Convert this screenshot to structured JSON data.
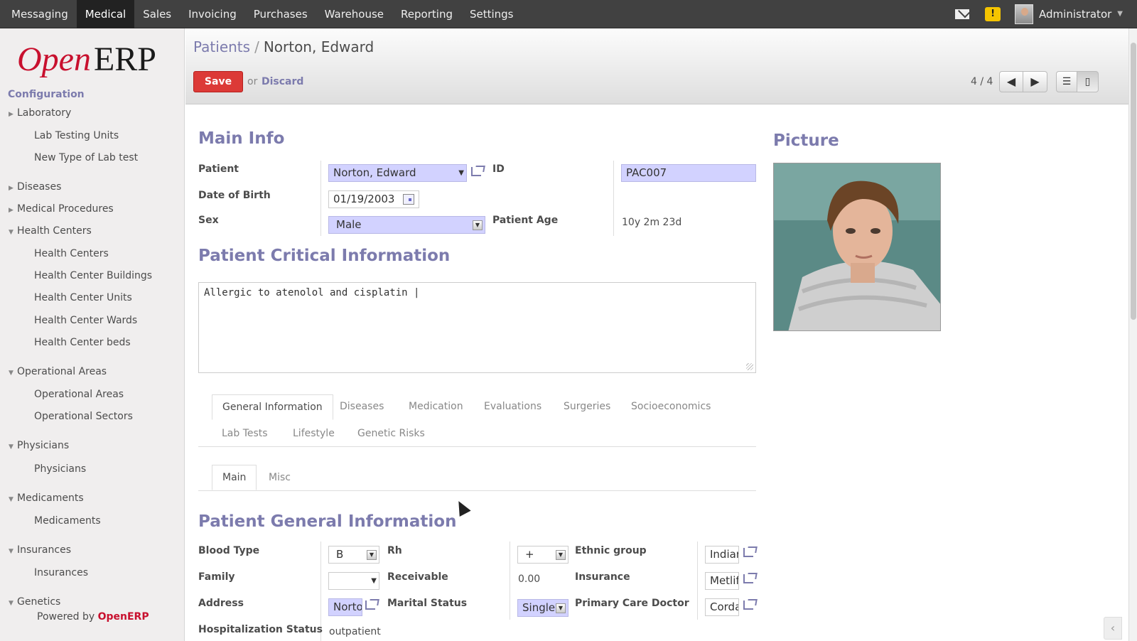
{
  "topbar": {
    "menu": [
      "Messaging",
      "Medical",
      "Sales",
      "Invoicing",
      "Purchases",
      "Warehouse",
      "Reporting",
      "Settings"
    ],
    "active": "Medical",
    "user": "Administrator",
    "warning_count": "!"
  },
  "sidebar": {
    "logo_open": "Open",
    "logo_erp": "ERP",
    "section": "Configuration",
    "items": [
      {
        "label": "Laboratory",
        "type": "cat",
        "expanded": false
      },
      {
        "label": "Lab Testing Units",
        "type": "sub"
      },
      {
        "label": "New Type of Lab test",
        "type": "sub"
      },
      {
        "label": "Diseases",
        "type": "cat",
        "expanded": false
      },
      {
        "label": "Medical Procedures",
        "type": "cat",
        "expanded": false
      },
      {
        "label": "Health Centers",
        "type": "cat",
        "expanded": true
      },
      {
        "label": "Health Centers",
        "type": "sub"
      },
      {
        "label": "Health Center Buildings",
        "type": "sub"
      },
      {
        "label": "Health Center Units",
        "type": "sub"
      },
      {
        "label": "Health Center Wards",
        "type": "sub"
      },
      {
        "label": "Health Center beds",
        "type": "sub"
      },
      {
        "label": "Operational Areas",
        "type": "cat",
        "expanded": true
      },
      {
        "label": "Operational Areas",
        "type": "sub"
      },
      {
        "label": "Operational Sectors",
        "type": "sub"
      },
      {
        "label": "Physicians",
        "type": "cat",
        "expanded": true
      },
      {
        "label": "Physicians",
        "type": "sub"
      },
      {
        "label": "Medicaments",
        "type": "cat",
        "expanded": true
      },
      {
        "label": "Medicaments",
        "type": "sub"
      },
      {
        "label": "Insurances",
        "type": "cat",
        "expanded": true
      },
      {
        "label": "Insurances",
        "type": "sub"
      },
      {
        "label": "Genetics",
        "type": "cat",
        "expanded": true
      }
    ],
    "powered_by": "Powered by",
    "powered_brand": "OpenERP"
  },
  "header": {
    "breadcrumb_parent": "Patients",
    "breadcrumb_sep": "/",
    "breadcrumb_current": "Norton, Edward",
    "save_label": "Save",
    "or_label": "or",
    "discard_label": "Discard",
    "pager": "4 / 4"
  },
  "main_info": {
    "title": "Main Info",
    "patient_label": "Patient",
    "patient_value": "Norton, Edward",
    "id_label": "ID",
    "id_value": "PAC007",
    "dob_label": "Date of Birth",
    "dob_value": "01/19/2003",
    "sex_label": "Sex",
    "sex_value": "Male",
    "age_label": "Patient Age",
    "age_value": "10y 2m 23d"
  },
  "picture": {
    "title": "Picture"
  },
  "critical": {
    "title": "Patient Critical Information",
    "text": "Allergic to atenolol and  cisplatin |"
  },
  "tabs": {
    "row1": [
      "General Information",
      "Diseases",
      "Medication",
      "Evaluations",
      "Surgeries",
      "Socioeconomics"
    ],
    "row2": [
      "Lab Tests",
      "Lifestyle",
      "Genetic Risks"
    ],
    "active": "General Information",
    "subtabs": [
      "Main",
      "Misc"
    ],
    "active_sub": "Main"
  },
  "general": {
    "title": "Patient General Information",
    "blood_type_label": "Blood Type",
    "blood_type_value": "B",
    "rh_label": "Rh",
    "rh_value": "+",
    "ethnic_label": "Ethnic group",
    "ethnic_value": "Indian",
    "family_label": "Family",
    "family_value": "",
    "receivable_label": "Receivable",
    "receivable_value": "0.00",
    "insurance_label": "Insurance",
    "insurance_value": "Metlife",
    "address_label": "Address",
    "address_value": "Norton",
    "marital_label": "Marital Status",
    "marital_value": "Single",
    "pcd_label": "Primary Care Doctor",
    "pcd_value": "Cordara",
    "hosp_label": "Hospitalization Status",
    "hosp_value": "outpatient"
  }
}
